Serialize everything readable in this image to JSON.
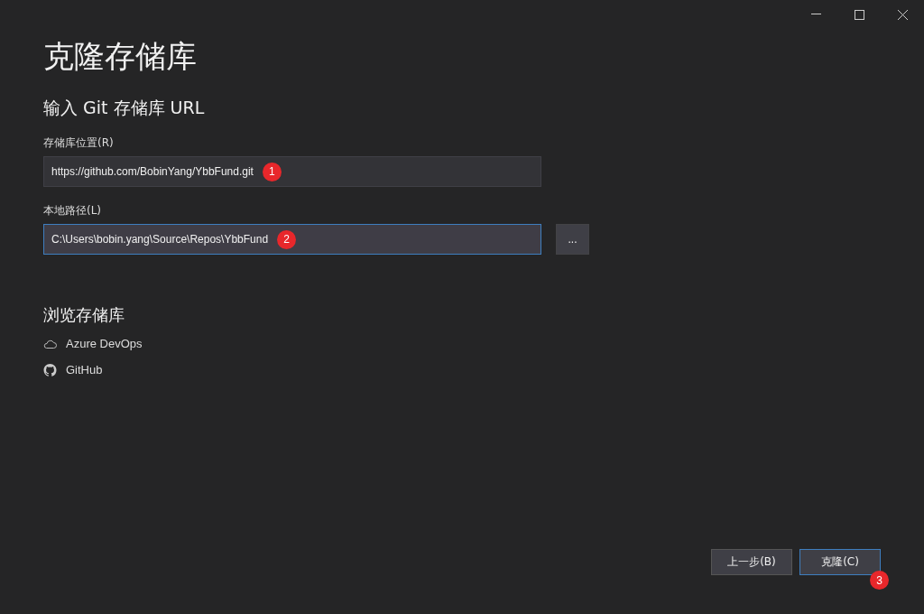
{
  "window": {
    "controls": [
      {
        "kind": "minimize"
      },
      {
        "kind": "maximize"
      },
      {
        "kind": "close"
      }
    ]
  },
  "title": "克隆存储库",
  "section": "输入 Git 存储库 URL",
  "fields": [
    {
      "label": "存储库位置(R)",
      "value": "https://github.com/BobinYang/YbbFund.git",
      "focused": false,
      "callout": "1",
      "browse": false
    },
    {
      "label": "本地路径(L)",
      "value": "C:\\Users\\bobin.yang\\Source\\Repos\\YbbFund",
      "focused": true,
      "callout": "2",
      "browse": true,
      "browse_label": "..."
    }
  ],
  "browse": {
    "heading": "浏览存储库",
    "items": [
      {
        "kind": "cloud",
        "label": "Azure DevOps"
      },
      {
        "kind": "github",
        "label": "GitHub"
      }
    ]
  },
  "buttons": [
    {
      "label": "上一步(B)",
      "default": false
    },
    {
      "label": "克隆(C)",
      "default": true,
      "callout": "3"
    }
  ]
}
